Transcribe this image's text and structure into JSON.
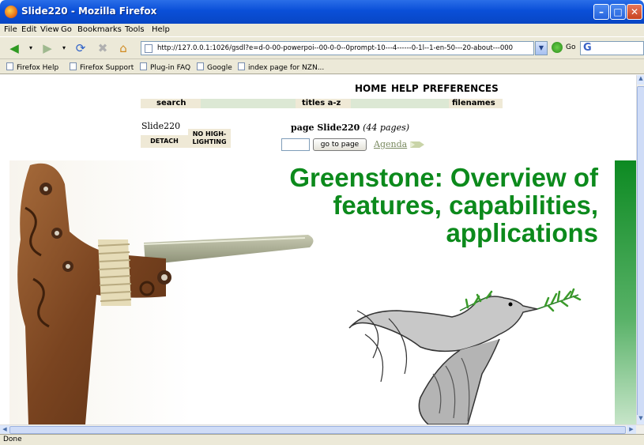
{
  "window": {
    "title": "Slide220 - Mozilla Firefox",
    "minimize_icon": "minimize-icon",
    "maximize_icon": "maximize-icon",
    "close_icon": "close-icon"
  },
  "menubar": {
    "items": [
      "File",
      "Edit",
      "View",
      "Go",
      "Bookmarks",
      "Tools",
      "Help"
    ]
  },
  "navbar": {
    "url": "http://127.0.0.1:1026/gsdl?e=d-0-00-powerpoi--00-0-0--0prompt-10---4------0-1l--1-en-50---20-about---000",
    "go_label": "Go",
    "search_logo": "G"
  },
  "bookmarks": {
    "items": [
      "Firefox Help",
      "Firefox Support",
      "Plug-in FAQ",
      "Google",
      "index page for NZN..."
    ]
  },
  "greenstone": {
    "top_links": [
      "HOME",
      "HELP",
      "PREFERENCES"
    ],
    "nav": {
      "search": "search",
      "titles": "titles a-z",
      "filenames": "filenames"
    },
    "doc_name": "Slide220",
    "detach": "DETACH",
    "no_highlighting": "NO HIGH- LIGHTING",
    "page_label": "page Slide220",
    "page_count": "(44 pages)",
    "goto_button": "go to page",
    "agenda_link": "Agenda"
  },
  "slide": {
    "title_line1": "Greenstone: Overview of",
    "title_line2": "features, capabilities,",
    "title_line3": "applications",
    "accent_color": "#0c8a1c"
  },
  "status": {
    "text": "Done"
  }
}
